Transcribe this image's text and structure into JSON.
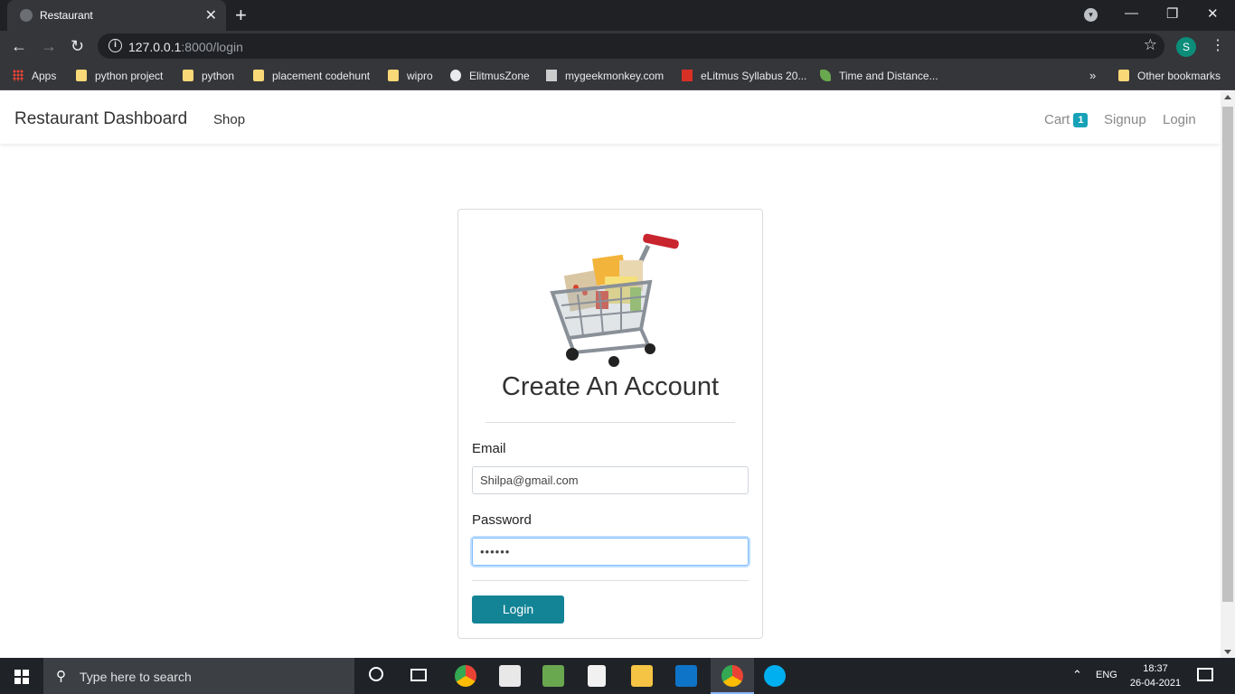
{
  "browser": {
    "tab_title": "Restaurant",
    "url_host": "127.0.0.1",
    "url_path": ":8000/login",
    "profile_initial": "S"
  },
  "bookmarks": [
    {
      "label": "Apps",
      "icon": "apps-grid-icon"
    },
    {
      "label": "python project",
      "icon": "folder-icon"
    },
    {
      "label": "python",
      "icon": "folder-icon"
    },
    {
      "label": "placement codehunt",
      "icon": "folder-icon"
    },
    {
      "label": "wipro",
      "icon": "folder-icon"
    },
    {
      "label": "ElitmusZone",
      "icon": "globe-icon"
    },
    {
      "label": "mygeekmonkey.com",
      "icon": "site-icon"
    },
    {
      "label": "eLitmus Syllabus 20...",
      "icon": "site-icon"
    },
    {
      "label": "Time and Distance...",
      "icon": "site-icon"
    }
  ],
  "other_bookmarks": "Other bookmarks",
  "navbar": {
    "brand": "Restaurant Dashboard",
    "shop": "Shop",
    "cart": "Cart",
    "cart_count": "1",
    "signup": "Signup",
    "login": "Login"
  },
  "form": {
    "title": "Create An Account",
    "email_label": "Email",
    "email_value": "Shilpa@gmail.com",
    "password_label": "Password",
    "password_value": "••••••",
    "submit": "Login"
  },
  "taskbar": {
    "search_placeholder": "Type here to search",
    "language": "ENG",
    "time": "18:37",
    "date": "26-04-2021"
  },
  "colors": {
    "accent": "#138496",
    "badge": "#17a2b8"
  }
}
